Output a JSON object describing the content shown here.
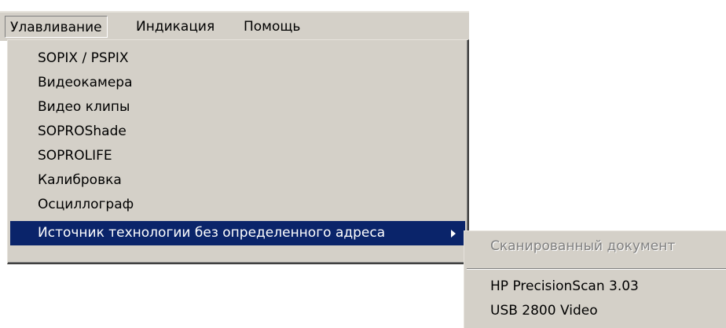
{
  "menubar": {
    "items": [
      {
        "label": "Улавливание"
      },
      {
        "label": "Индикация"
      },
      {
        "label": "Помощь"
      }
    ]
  },
  "capture_menu": {
    "items": [
      {
        "label": "SOPIX / PSPIX"
      },
      {
        "label": "Видеокамера"
      },
      {
        "label": "Видео клипы"
      },
      {
        "label": "SOPROShade"
      },
      {
        "label": "SOPROLIFE"
      },
      {
        "label": "Калибровка"
      },
      {
        "label": "Осциллограф"
      },
      {
        "label": "Источник технологии без определенного адреса"
      }
    ],
    "selected_index": 7
  },
  "source_submenu": {
    "items": [
      {
        "label": "Сканированный документ",
        "enabled": false
      },
      {
        "label": "HP PrecisionScan 3.03",
        "enabled": true
      },
      {
        "label": "USB 2800 Video",
        "enabled": true
      }
    ]
  },
  "colors": {
    "menu_background": "#d4d0c8",
    "highlight": "#0a246a",
    "disabled_text": "#808080"
  }
}
